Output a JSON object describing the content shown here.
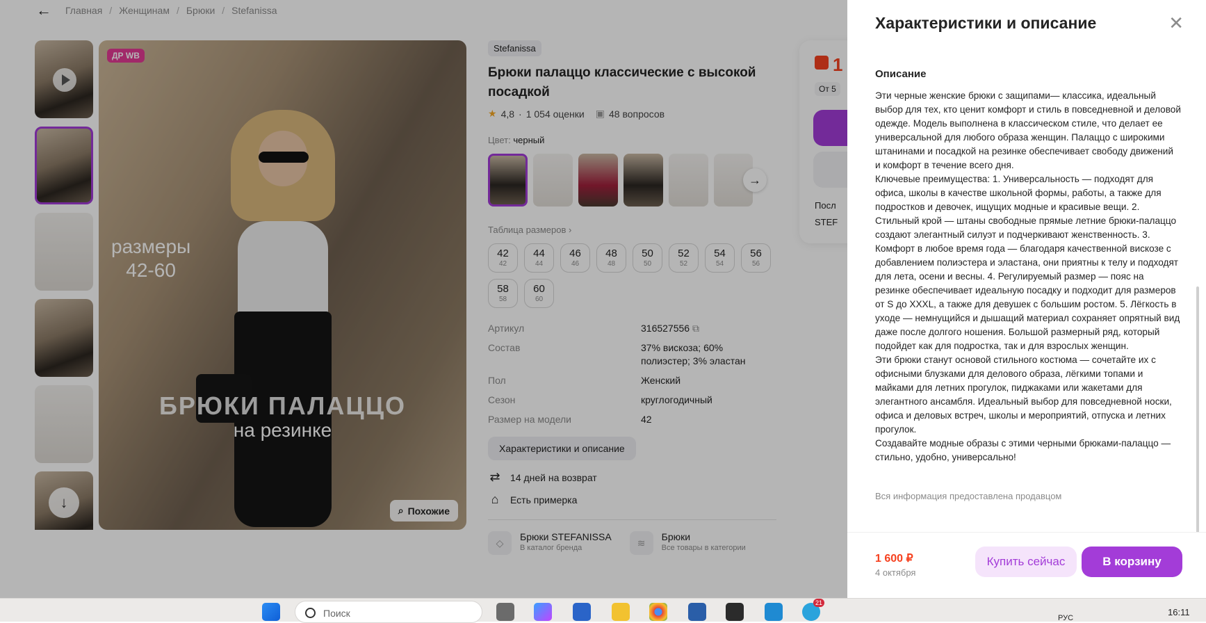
{
  "breadcrumb": {
    "back_icon": "arrow-left-icon",
    "items": [
      "Главная",
      "Женщинам",
      "Брюки",
      "Stefanissa"
    ]
  },
  "gallery": {
    "badge": "ДР WB",
    "photo_text_sizes": "размеры\n42-60",
    "photo_text_title": "БРЮКИ ПАЛАЦЦО",
    "photo_text_sub": "на резинке",
    "similar_label": "Похожие"
  },
  "product": {
    "brand": "Stefanissa",
    "title": "Брюки палаццо классические с высокой посадкой",
    "rating": "4,8",
    "reviews": "1 054 оценки",
    "questions": "48 вопросов",
    "color_label": "Цвет:",
    "color_value": "черный",
    "size_table_label": "Таблица размеров",
    "sizes": [
      {
        "ru": "42",
        "alt": "42"
      },
      {
        "ru": "44",
        "alt": "44"
      },
      {
        "ru": "46",
        "alt": "46"
      },
      {
        "ru": "48",
        "alt": "48"
      },
      {
        "ru": "50",
        "alt": "50"
      },
      {
        "ru": "52",
        "alt": "52"
      },
      {
        "ru": "54",
        "alt": "54"
      },
      {
        "ru": "56",
        "alt": "56"
      },
      {
        "ru": "58",
        "alt": "58"
      },
      {
        "ru": "60",
        "alt": "60"
      }
    ],
    "props": [
      {
        "k": "Артикул",
        "v": "316527556"
      },
      {
        "k": "Состав",
        "v": "37% вискоза; 60% полиэстер; 3% эластан"
      },
      {
        "k": "Пол",
        "v": "Женский"
      },
      {
        "k": "Сезон",
        "v": "круглогодичный"
      },
      {
        "k": "Размер на модели",
        "v": "42"
      }
    ],
    "char_button": "Характеристики и описание",
    "features": [
      "14 дней на возврат",
      "Есть примерка"
    ],
    "links": [
      {
        "title": "Брюки STEFANISSA",
        "sub": "В каталог бренда"
      },
      {
        "title": "Брюки",
        "sub": "Все товары в категории"
      }
    ]
  },
  "buycard": {
    "price_partial": "1",
    "from_partial": "От 5",
    "line1": "Посл",
    "line2": "STEF"
  },
  "panel": {
    "title": "Характеристики и описание",
    "close_icon": "close-icon",
    "subtitle": "Описание",
    "description": "Эти черные женские брюки с защипами— классика, идеальный выбор для тех, кто ценит комфорт и стиль в повседневной и деловой одежде. Модель выполнена в классическом стиле, что делает ее универсальной для любого образа женщин. Палаццо с широкими штанинами и посадкой на резинке обеспечивает свободу движений и комфорт в течение всего дня.\nКлючевые преимущества: 1. Универсальность — подходят для офиса, школы в качестве школьной формы, работы, а также для подростков и девочек, ищущих модные и красивые вещи. 2. Стильный крой — штаны свободные прямые летние брюки-палаццо создают элегантный силуэт и подчеркивают женственность. 3. Комфорт в любое время года — благодаря качественной вискозе с добавлением полиэстера и эластана, они приятны к телу и подходят для лета, осени и весны. 4. Регулируемый размер — пояс на резинке обеспечивает идеальную посадку и подходит для размеров от S до XXXL, а также для девушек с большим ростом. 5. Лёгкость в уходе — немнущийся и дышащий материал сохраняет опрятный вид даже после долгого ношения. Большой размерный ряд, который подойдет как для подростка, так и для взрослых женщин.\nЭти брюки станут основой стильного костюма — сочетайте их с офисными блузками для делового образа, лёгкими топами и майками для летних прогулок, пиджаками или жакетами для элегантного ансамбля. Идеальный выбор для повседневной носки, офиса и деловых встреч, школы и мероприятий, отпуска и летних прогулок.\nСоздавайте модные образы с этими черными брюками-палаццо — стильно, удобно, универсально!",
    "note": "Вся информация предоставлена продавцом",
    "price": "1 600 ₽",
    "delivery": "4 октября",
    "buy_now": "Купить сейчас",
    "to_cart": "В корзину"
  },
  "taskbar": {
    "search_placeholder": "Поиск",
    "lang": "РУС",
    "time": "16:11",
    "badge": "21"
  },
  "colors": {
    "accent": "#a33cd8",
    "price": "#f6411f",
    "badge": "#e33a95"
  }
}
